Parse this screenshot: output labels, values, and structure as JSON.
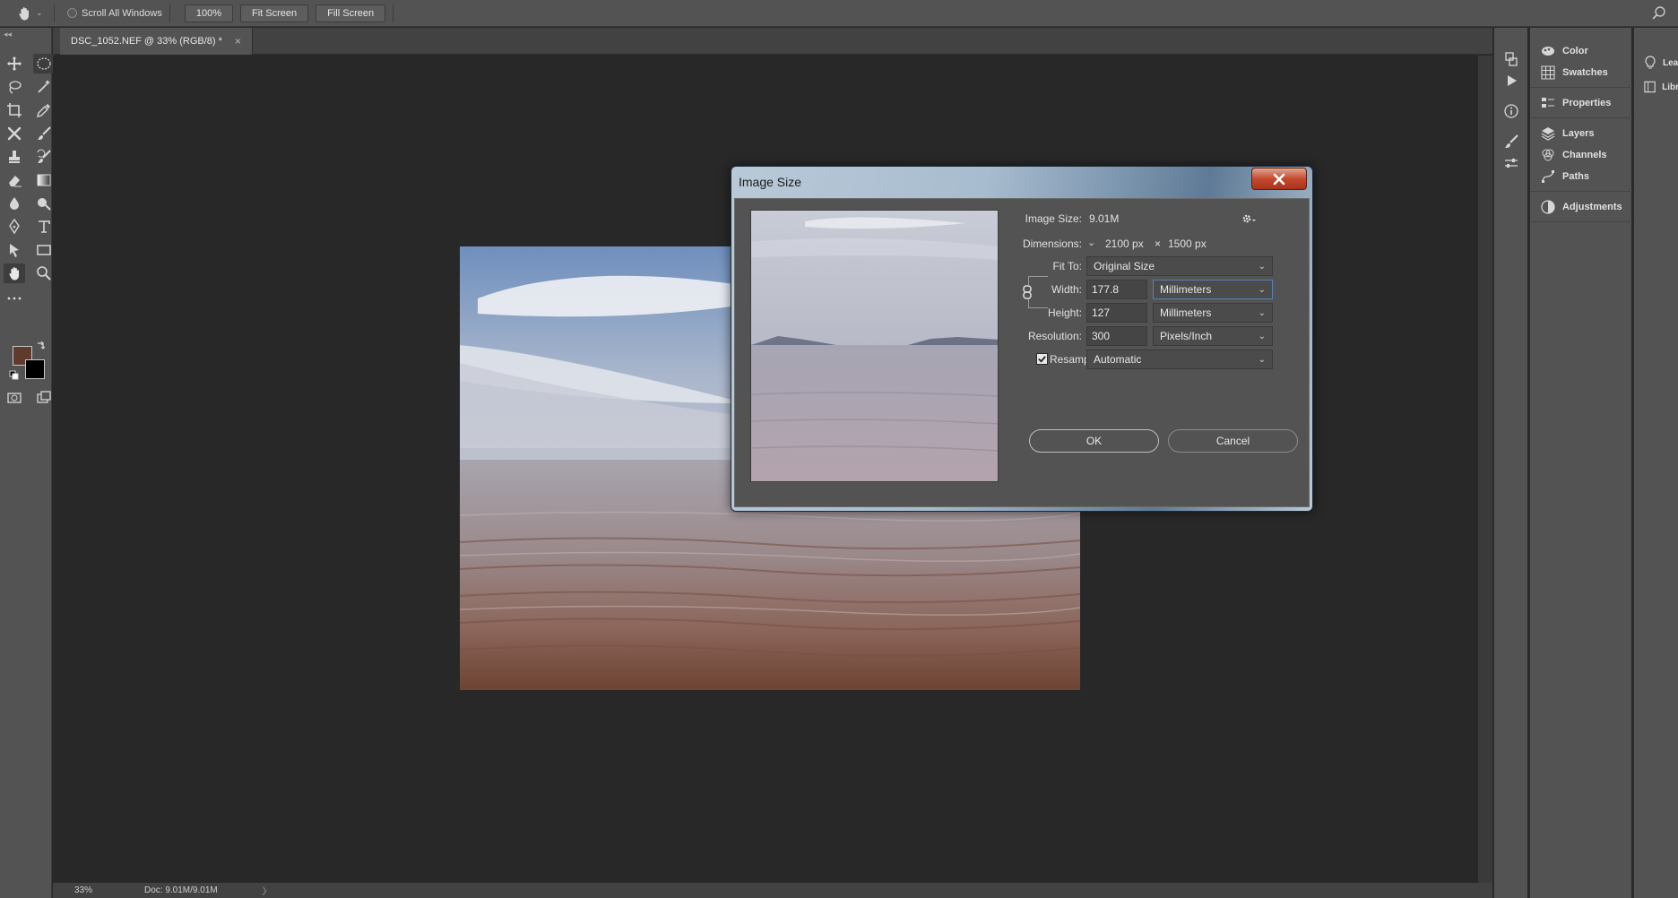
{
  "options_bar": {
    "scroll_all_windows": "Scroll All Windows",
    "zoom_100": "100%",
    "fit_screen": "Fit Screen",
    "fill_screen": "Fill Screen"
  },
  "document_tab": {
    "title": "DSC_1052.NEF @ 33% (RGB/8) *",
    "close": "×"
  },
  "status_bar": {
    "zoom": "33%",
    "doc_size": "Doc: 9.01M/9.01M",
    "arrow": "〉"
  },
  "colors": {
    "foreground": "#5f3b2e",
    "background": "#000000"
  },
  "right_panel": {
    "items": [
      {
        "label": "Color",
        "icon": "color-icon"
      },
      {
        "label": "Swatches",
        "icon": "swatches-icon"
      },
      {
        "label": "Properties",
        "icon": "properties-icon"
      },
      {
        "label": "Layers",
        "icon": "layers-icon"
      },
      {
        "label": "Channels",
        "icon": "channels-icon"
      },
      {
        "label": "Paths",
        "icon": "paths-icon"
      },
      {
        "label": "Adjustments",
        "icon": "adjustments-icon"
      }
    ],
    "far_items": [
      {
        "label": "Lea",
        "icon": "learn-icon"
      },
      {
        "label": "Libr",
        "icon": "libraries-icon"
      }
    ]
  },
  "dialog": {
    "title": "Image Size",
    "image_size_label": "Image Size:",
    "image_size_value": "9.01M",
    "dimensions_label": "Dimensions:",
    "dimensions_width": "2100 px",
    "dimensions_x": "×",
    "dimensions_height": "1500 px",
    "fit_to_label": "Fit To:",
    "fit_to_value": "Original Size",
    "width_label": "Width:",
    "width_value": "177.8",
    "width_unit": "Millimeters",
    "height_label": "Height:",
    "height_value": "127",
    "height_unit": "Millimeters",
    "resolution_label": "Resolution:",
    "resolution_value": "300",
    "resolution_unit": "Pixels/Inch",
    "resample_label": "Resample:",
    "resample_checked": true,
    "resample_value": "Automatic",
    "ok": "OK",
    "cancel": "Cancel"
  }
}
